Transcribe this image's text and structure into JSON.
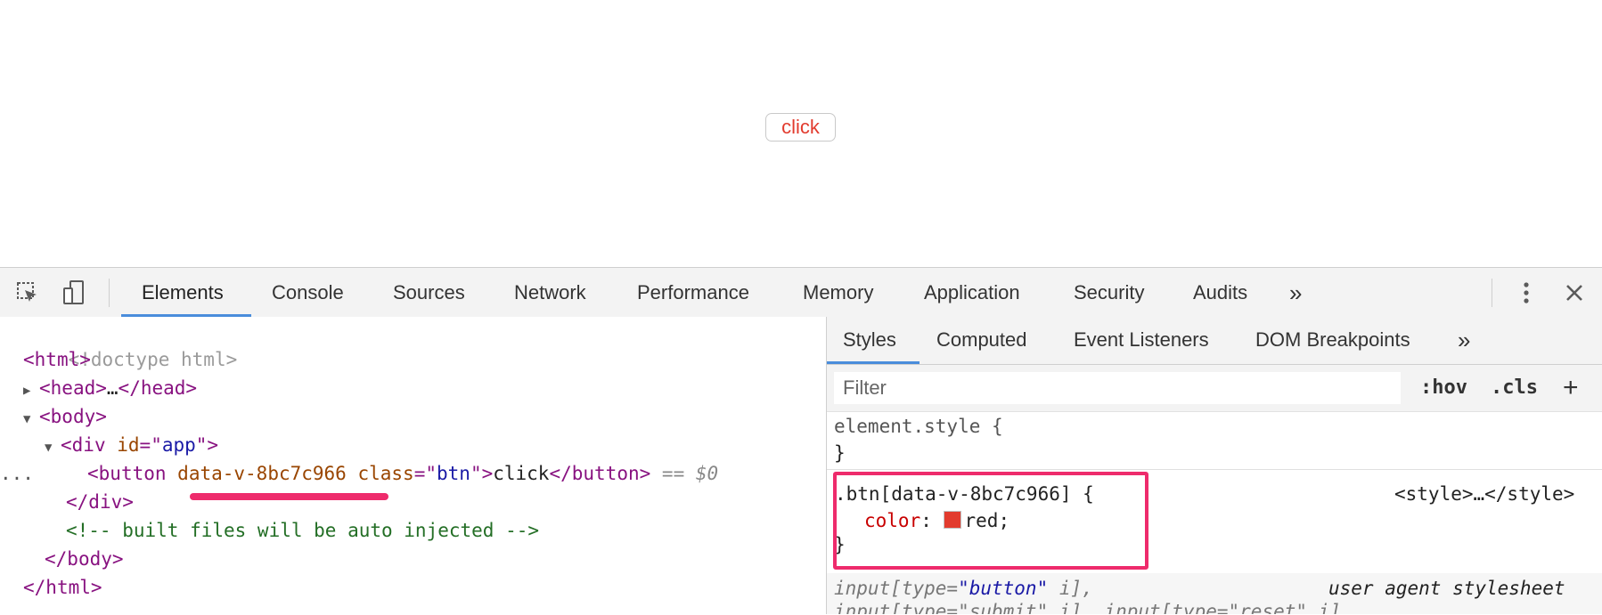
{
  "page": {
    "button_label": "click"
  },
  "devtools": {
    "toolbar": {
      "tabs": [
        "Elements",
        "Console",
        "Sources",
        "Network",
        "Performance",
        "Memory",
        "Application",
        "Security",
        "Audits"
      ],
      "overflow_label": "»",
      "active_tab": "Elements"
    },
    "elements": {
      "doctype": "<!doctype html>",
      "html_open": "html",
      "head": "head",
      "head_ellipsis": "…",
      "body": "body",
      "div": "div",
      "div_attr_name": "id",
      "div_attr_value": "app",
      "button_tag": "button",
      "button_scoped_attr": "data-v-8bc7c966",
      "button_class_name": "class",
      "button_class_value": "btn",
      "button_text": "click",
      "selected_marker": "== $0",
      "selected_eq": "==",
      "selected_dollar": "$0",
      "row_dots": "...",
      "comment": "<!-- built files will be auto injected -->",
      "colors": {
        "tag": "#881280",
        "attr_name": "#994500",
        "attr_value": "#1a1aa6",
        "comment": "#236e25",
        "highlight": "#ee2b6c"
      }
    },
    "styles_pane": {
      "subtabs": [
        "Styles",
        "Computed",
        "Event Listeners",
        "DOM Breakpoints"
      ],
      "overflow_label": "»",
      "active_subtab": "Styles",
      "filter_placeholder": "Filter",
      "hov_label": ":hov",
      "cls_label": ".cls",
      "add_label": "+",
      "element_style": "element.style {",
      "close_brace": "}",
      "rule_selector": ".btn[data-v-8bc7c966] {",
      "rule_source": "<style>…</style>",
      "property_name": "color",
      "property_value": "red;",
      "swatch_color": "#e23b2e",
      "ua_selector_1_a": "input[type=",
      "ua_selector_1_b": "\"button\"",
      "ua_selector_1_c": " i],",
      "ua_source": "user agent stylesheet",
      "ua_selector_2": "input[type=\"submit\" i], input[type=\"reset\" i],"
    }
  }
}
